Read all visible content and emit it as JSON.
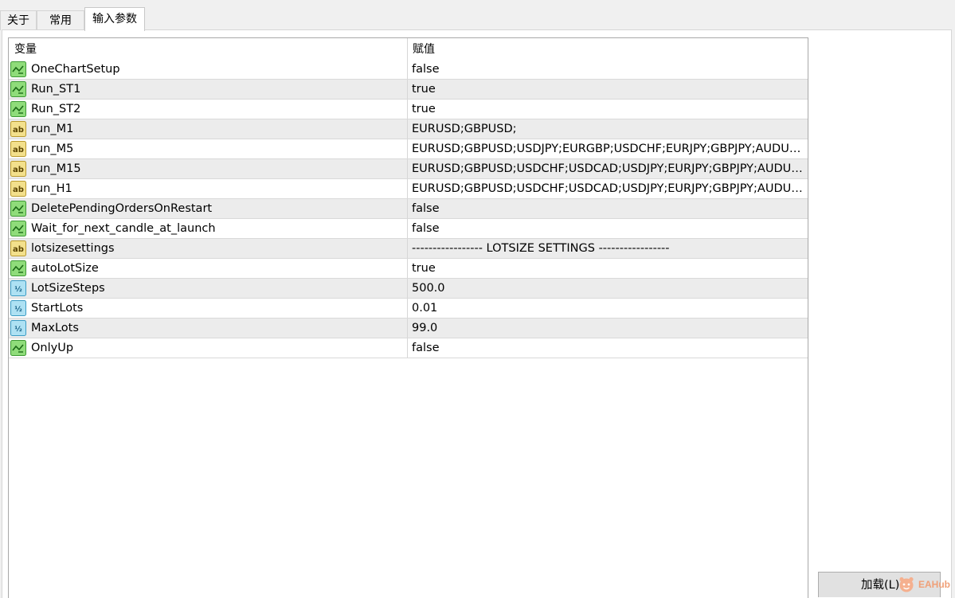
{
  "tabs": [
    {
      "label": "关于",
      "active": false
    },
    {
      "label": "常用",
      "active": false
    },
    {
      "label": "输入参数",
      "active": true
    }
  ],
  "table": {
    "columns": [
      "变量",
      "赋值"
    ],
    "rows": [
      {
        "type": "bool",
        "icon": "bool-param-icon",
        "name": "OneChartSetup",
        "value": "false"
      },
      {
        "type": "bool",
        "icon": "bool-param-icon",
        "name": "Run_ST1",
        "value": "true"
      },
      {
        "type": "bool",
        "icon": "bool-param-icon",
        "name": "Run_ST2",
        "value": "true"
      },
      {
        "type": "string",
        "icon": "string-param-icon",
        "name": "run_M1",
        "value": "EURUSD;GBPUSD;"
      },
      {
        "type": "string",
        "icon": "string-param-icon",
        "name": "run_M5",
        "value": "EURUSD;GBPUSD;USDJPY;EURGBP;USDCHF;EURJPY;GBPJPY;AUDUSD;NZDUSD;USDCAD;"
      },
      {
        "type": "string",
        "icon": "string-param-icon",
        "name": "run_M15",
        "value": "EURUSD;GBPUSD;USDCHF;USDCAD;USDJPY;EURJPY;GBPJPY;AUDUSD;NZDUSD;EURGBP;"
      },
      {
        "type": "string",
        "icon": "string-param-icon",
        "name": "run_H1",
        "value": "EURUSD;GBPUSD;USDCHF;USDCAD;USDJPY;EURJPY;GBPJPY;AUDUSD;NZDUSD;EURGBP;"
      },
      {
        "type": "bool",
        "icon": "bool-param-icon",
        "name": "DeletePendingOrdersOnRestart",
        "value": "false"
      },
      {
        "type": "bool",
        "icon": "bool-param-icon",
        "name": "Wait_for_next_candle_at_launch",
        "value": "false"
      },
      {
        "type": "string",
        "icon": "string-param-icon",
        "name": "lotsizesettings",
        "value": "----------------- LOTSIZE SETTINGS -----------------"
      },
      {
        "type": "bool",
        "icon": "bool-param-icon",
        "name": "autoLotSize",
        "value": "true"
      },
      {
        "type": "double",
        "icon": "double-param-icon",
        "name": "LotSizeSteps",
        "value": "500.0"
      },
      {
        "type": "double",
        "icon": "double-param-icon",
        "name": "StartLots",
        "value": "0.01"
      },
      {
        "type": "double",
        "icon": "double-param-icon",
        "name": "MaxLots",
        "value": "99.0"
      },
      {
        "type": "bool",
        "icon": "bool-param-icon",
        "name": "OnlyUp",
        "value": "false"
      }
    ]
  },
  "buttons": {
    "load_label": "加载(L)"
  },
  "watermark": {
    "text": "EAHub"
  },
  "colors": {
    "bool_icon_bg": "#8fdc7a",
    "bool_icon_border": "#3e9a35",
    "string_icon_bg": "#f3e08c",
    "string_icon_border": "#b99a2e",
    "double_icon_bg": "#aee1f3",
    "double_icon_border": "#3c9cc4",
    "watermark": "#f0a078"
  }
}
